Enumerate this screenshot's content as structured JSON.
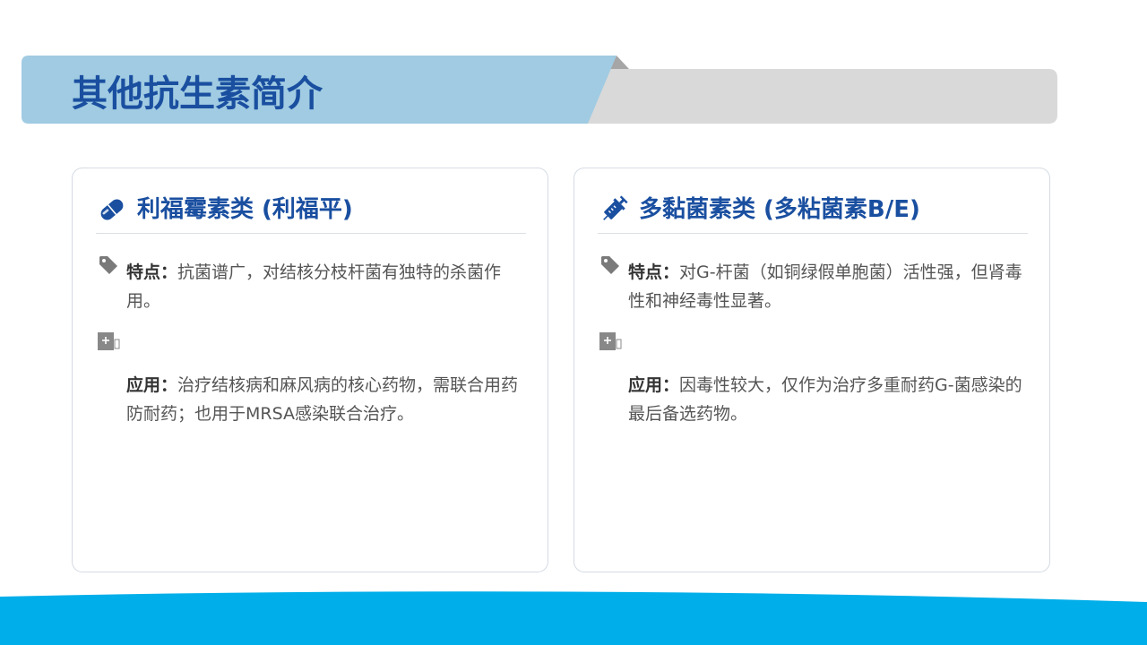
{
  "page": {
    "title": "其他抗生素简介",
    "colors": {
      "title_blue": "#1a4fa0",
      "band_light_blue": "#a0cbe2",
      "band_grey": "#d9d9d9",
      "footer_cyan": "#00aee9"
    }
  },
  "cards": [
    {
      "title": "利福霉素类 (利福平)",
      "icon": "capsule-icon",
      "feature_label": "特点：",
      "feature_text": "抗菌谱广，对结核分枝杆菌有独特的杀菌作用。",
      "application_label": "应用：",
      "application_text": "治疗结核病和麻风病的核心药物，需联合用药防耐药；也用于MRSA感染联合治疗。"
    },
    {
      "title": "多黏菌素类 (多粘菌素B/E)",
      "icon": "syringe-icon",
      "feature_label": "特点：",
      "feature_text": "对G-杆菌（如铜绿假单胞菌）活性强，但肾毒性和神经毒性显著。",
      "application_label": "应用：",
      "application_text": "因毒性较大，仅作为治疗多重耐药G-菌感染的最后备选药物。"
    }
  ]
}
